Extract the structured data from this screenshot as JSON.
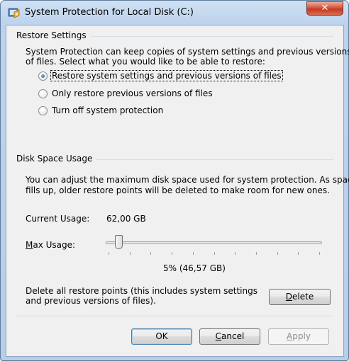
{
  "window": {
    "title": "System Protection for Local Disk (C:)",
    "close_glyph": "✕"
  },
  "restore_settings": {
    "heading": "Restore Settings",
    "description_line1": "System Protection can keep copies of system settings and previous versions",
    "description_line2": "of files. Select what you would like to be able to restore:",
    "options": [
      {
        "label": "Restore system settings and previous versions of files",
        "checked": true
      },
      {
        "label": "Only restore previous versions of files",
        "checked": false
      },
      {
        "label": "Turn off system protection",
        "checked": false
      }
    ]
  },
  "disk_space": {
    "heading": "Disk Space Usage",
    "description_line1": "You can adjust the maximum disk space used for system protection. As space",
    "description_line2": "fills up, older restore points will be deleted to make room for new ones.",
    "current_usage_label": "Current Usage:",
    "current_usage_value": "62,00 GB",
    "max_usage_label_mnemonic": "M",
    "max_usage_label_rest": "ax Usage:",
    "max_usage_percent": 0.05,
    "max_usage_text": "5% (46,57 GB)",
    "delete_text_line1": "Delete all restore points (this includes system settings",
    "delete_text_line2": "and previous versions of files).",
    "delete_button_mnemonic": "D",
    "delete_button_rest": "elete"
  },
  "footer": {
    "ok_label": "OK",
    "cancel_mnemonic": "C",
    "cancel_rest": "ancel",
    "apply_mnemonic": "A",
    "apply_rest": "pply"
  },
  "colors": {
    "title_gradient_top": "#cfe0f3",
    "close_button_red": "#c23b22",
    "client_background": "#f0f0f0",
    "radio_selected": "#1d4f96"
  },
  "icons": {
    "window_icon": "system-protection-icon",
    "close": "close-icon"
  }
}
